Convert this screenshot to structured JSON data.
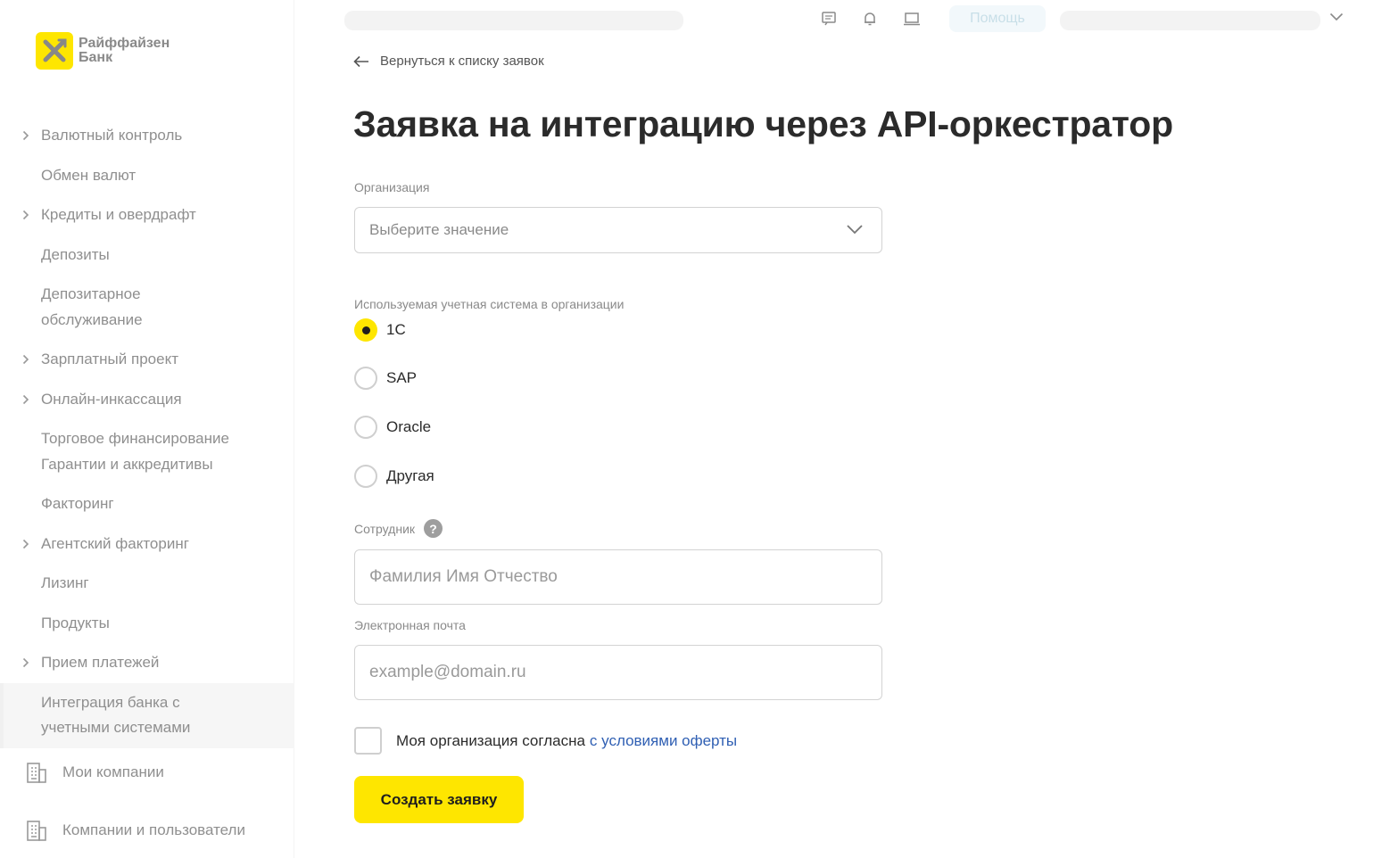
{
  "brand": {
    "name_line1": "Райффайзен",
    "name_line2": "Банк",
    "accent_color": "#fee600"
  },
  "header": {
    "icons": [
      "chat-icon",
      "bell-icon",
      "laptop-icon"
    ],
    "help_label": "Помощь"
  },
  "sidebar": {
    "items": [
      {
        "label": "Валютный контроль",
        "expandable": true
      },
      {
        "label": "Обмен валют",
        "expandable": false
      },
      {
        "label": "Кредиты и овердрафт",
        "expandable": true
      },
      {
        "label": "Депозиты",
        "expandable": false
      },
      {
        "label": "Депозитарное обслуживание",
        "expandable": false
      },
      {
        "label": "Зарплатный проект",
        "expandable": true
      },
      {
        "label": "Онлайн-инкассация",
        "expandable": true
      },
      {
        "label": "Торговое финансирование Гарантии и аккредитивы",
        "expandable": false
      },
      {
        "label": "Факторинг",
        "expandable": false
      },
      {
        "label": "Агентский факторинг",
        "expandable": true
      },
      {
        "label": "Лизинг",
        "expandable": false
      },
      {
        "label": "Продукты",
        "expandable": false
      },
      {
        "label": "Прием платежей",
        "expandable": true
      },
      {
        "label": "Интеграция банка с учетными системами",
        "expandable": false,
        "active": true
      }
    ],
    "companies_label": "Мои компании",
    "users_label": "Компании и пользователи"
  },
  "main": {
    "back_label": "Вернуться к списку заявок",
    "title": "Заявка на интеграцию через API-оркестратор",
    "organization": {
      "label": "Организация",
      "placeholder": "Выберите значение"
    },
    "accounting": {
      "label": "Используемая учетная система в организации",
      "options": [
        {
          "label": "1С",
          "checked": true
        },
        {
          "label": "SAP",
          "checked": false
        },
        {
          "label": "Oracle",
          "checked": false
        },
        {
          "label": "Другая",
          "checked": false
        }
      ]
    },
    "employee": {
      "label": "Сотрудник",
      "help": "?",
      "placeholder": "Фамилия Имя Отчество"
    },
    "email": {
      "label": "Электронная почта",
      "placeholder": "example@domain.ru"
    },
    "consent": {
      "text": "Моя организация согласна",
      "link": "с условиями оферты",
      "checked": false
    },
    "submit_label": "Создать заявку"
  }
}
